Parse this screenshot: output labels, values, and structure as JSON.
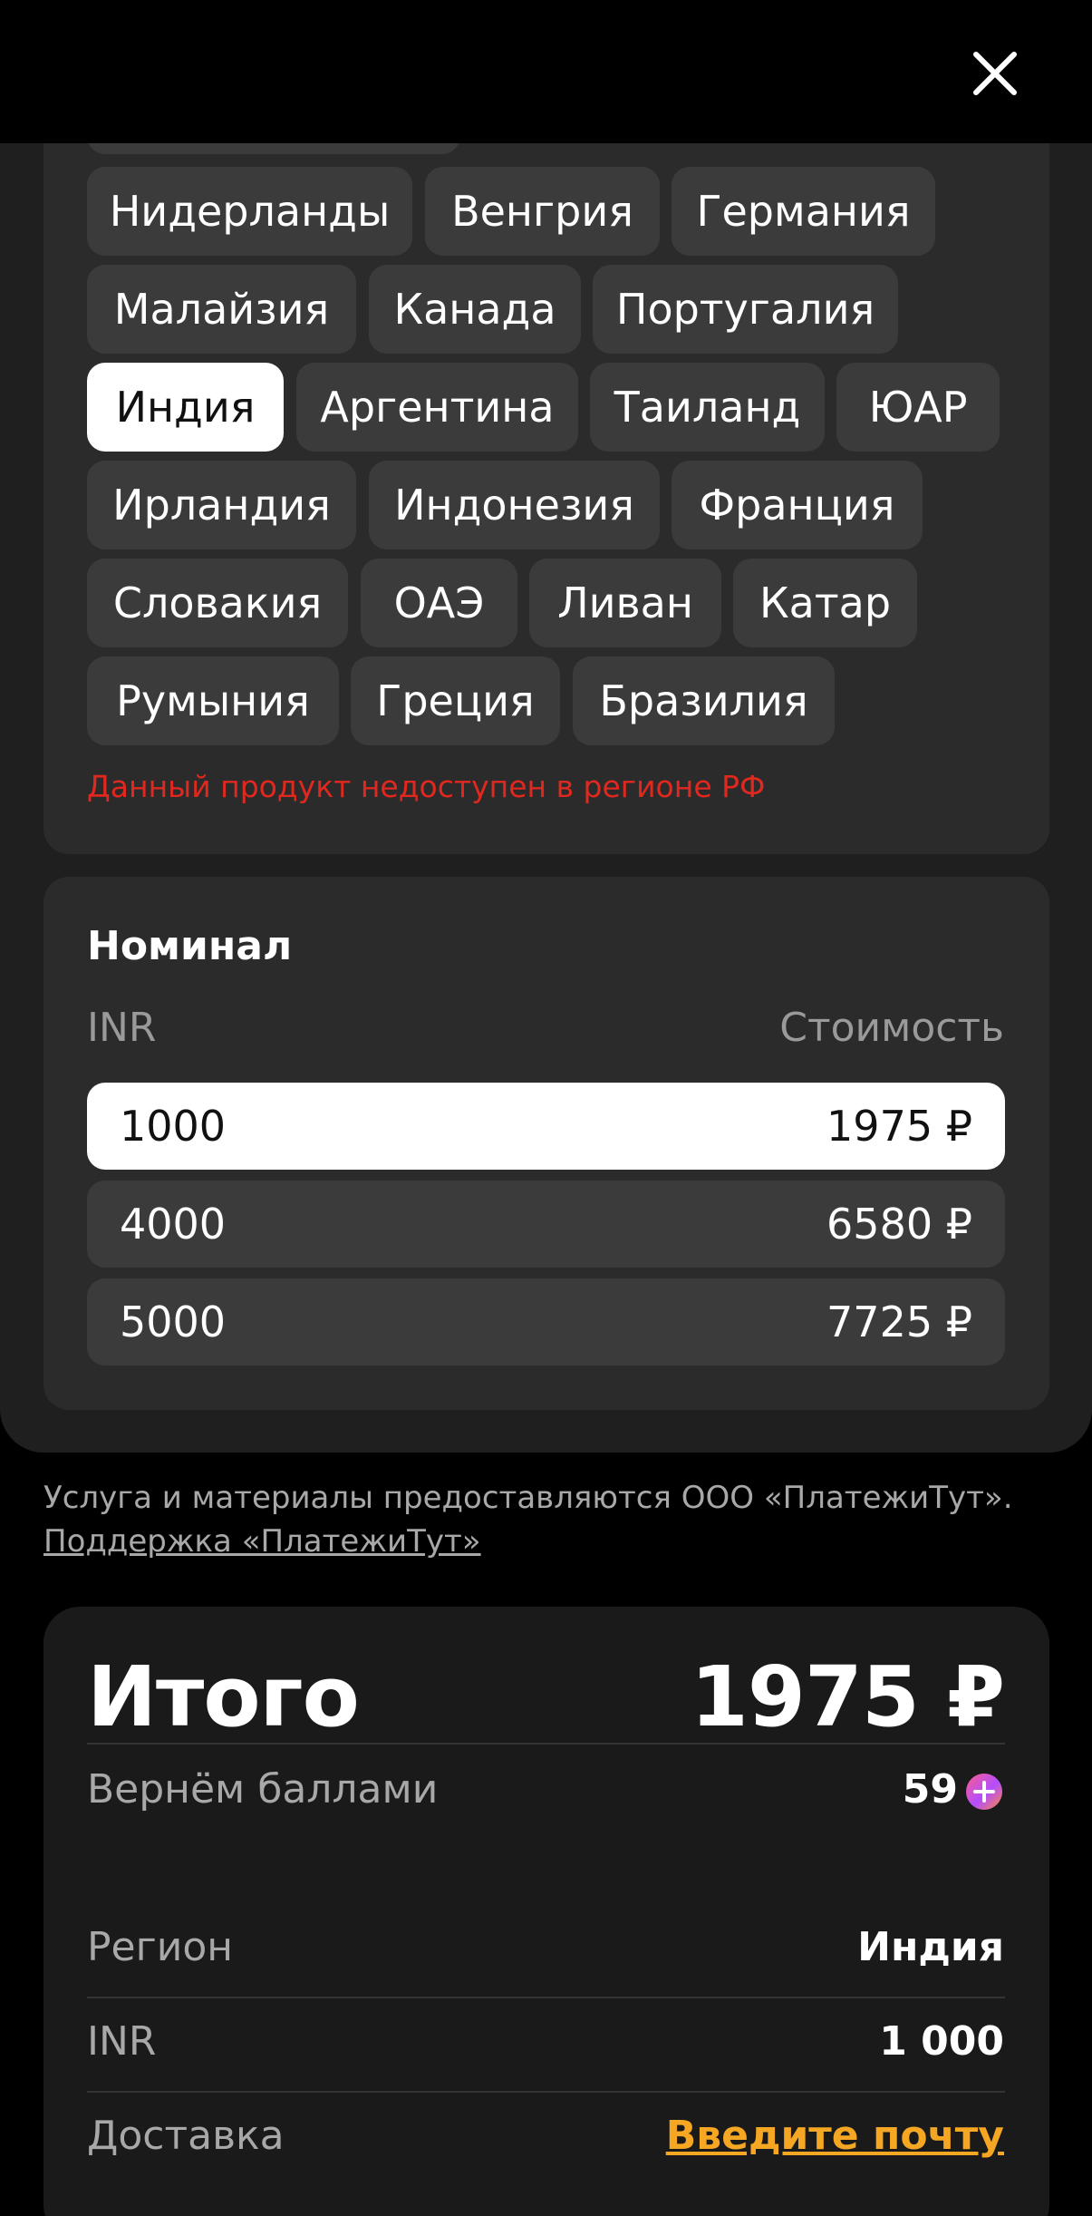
{
  "regions": {
    "chips": [
      {
        "label": "Нидерланды",
        "selected": false
      },
      {
        "label": "Венгрия",
        "selected": false
      },
      {
        "label": "Германия",
        "selected": false
      },
      {
        "label": "Малайзия",
        "selected": false
      },
      {
        "label": "Канада",
        "selected": false
      },
      {
        "label": "Португалия",
        "selected": false
      },
      {
        "label": "Индия",
        "selected": true
      },
      {
        "label": "Аргентина",
        "selected": false
      },
      {
        "label": "Таиланд",
        "selected": false
      },
      {
        "label": "ЮАР",
        "selected": false
      },
      {
        "label": "Ирландия",
        "selected": false
      },
      {
        "label": "Индонезия",
        "selected": false
      },
      {
        "label": "Франция",
        "selected": false
      },
      {
        "label": "Словакия",
        "selected": false
      },
      {
        "label": "ОАЭ",
        "selected": false
      },
      {
        "label": "Ливан",
        "selected": false
      },
      {
        "label": "Катар",
        "selected": false
      },
      {
        "label": "Румыния",
        "selected": false
      },
      {
        "label": "Греция",
        "selected": false
      },
      {
        "label": "Бразилия",
        "selected": false
      }
    ],
    "warning": "Данный продукт недоступен в регионе РФ"
  },
  "nominal": {
    "title": "Номинал",
    "currency_header": "INR",
    "cost_header": "Стоимость",
    "rows": [
      {
        "amount": "1000",
        "price": "1975 ₽",
        "selected": true
      },
      {
        "amount": "4000",
        "price": "6580 ₽",
        "selected": false
      },
      {
        "amount": "5000",
        "price": "7725 ₽",
        "selected": false
      }
    ]
  },
  "legal": {
    "text": "Услуга и материалы предоставляются ООО «ПлатежиТут».",
    "support_link": "Поддержка «ПлатежиТут»"
  },
  "summary": {
    "total_label": "Итого",
    "total_value": "1975 ₽",
    "cashback_label": "Вернём баллами",
    "cashback_value": "59",
    "region_label": "Регион",
    "region_value": "Индия",
    "currency_label": "INR",
    "currency_value": "1 000",
    "delivery_label": "Доставка",
    "delivery_action": "Введите почту"
  },
  "icons": {
    "close": "close-icon",
    "plus_points": "plus-points-icon"
  },
  "colors": {
    "warning": "#e0281f",
    "accent_link": "#f5a623",
    "selected_bg": "#ffffff",
    "chip_bg": "#3b3b3b"
  }
}
